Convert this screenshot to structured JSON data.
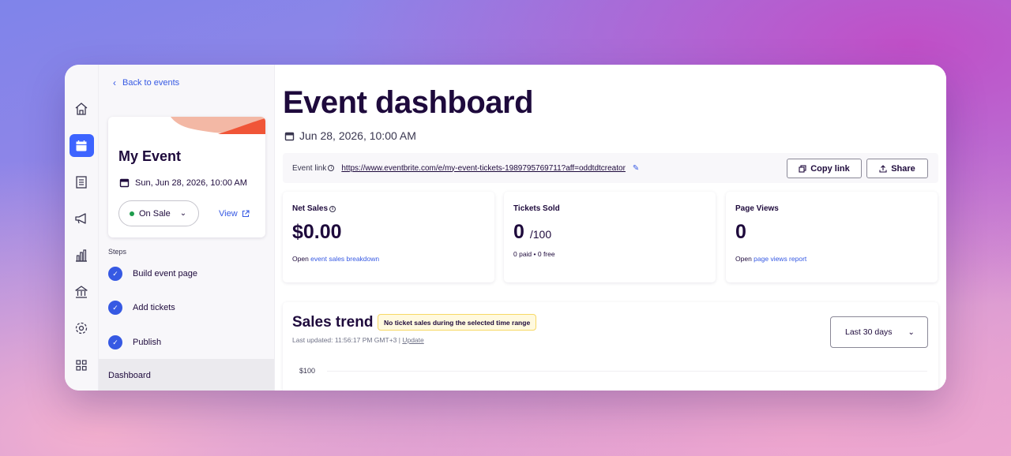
{
  "sidebar": {
    "back_label": "Back to events",
    "event_name": "My Event",
    "event_datetime": "Sun, Jun 28, 2026, 10:00 AM",
    "status_label": "On Sale",
    "view_label": "View",
    "steps_heading": "Steps",
    "steps": [
      {
        "label": "Build event page",
        "done": true
      },
      {
        "label": "Add tickets",
        "done": true
      },
      {
        "label": "Publish",
        "done": true
      }
    ],
    "nav_dashboard": "Dashboard"
  },
  "rail": {
    "icons": [
      "home-icon",
      "calendar-icon",
      "orders-icon",
      "megaphone-icon",
      "chart-icon",
      "bank-icon",
      "gear-icon",
      "apps-grid-icon"
    ],
    "active_icon": "calendar-icon"
  },
  "header": {
    "title": "Event dashboard",
    "datetime": "Jun 28, 2026, 10:00 AM"
  },
  "event_link": {
    "label": "Event link",
    "url": "https://www.eventbrite.com/e/my-event-tickets-1989795769711?aff=oddtdtcreator",
    "copy_label": "Copy link",
    "share_label": "Share"
  },
  "stats": {
    "net_sales": {
      "label": "Net Sales",
      "value": "$0.00",
      "foot_prefix": "Open",
      "foot_link": "event sales breakdown"
    },
    "tickets_sold": {
      "label": "Tickets Sold",
      "value": "0",
      "of": "/100",
      "foot": "0 paid • 0 free"
    },
    "page_views": {
      "label": "Page Views",
      "value": "0",
      "foot_prefix": "Open",
      "foot_link": "page views report"
    }
  },
  "sales_trend": {
    "title": "Sales trend",
    "badge": "No ticket sales during the selected time range",
    "updated_prefix": "Last updated: 11:56:17 PM GMT+3 |",
    "update_link": "Update",
    "range": "Last 30 days",
    "axis_top": "$100"
  },
  "colors": {
    "accent": "#3659e3",
    "brand_dark": "#1e0a3c",
    "status_green": "#1e9c4c",
    "card_accent": "#f05537"
  }
}
